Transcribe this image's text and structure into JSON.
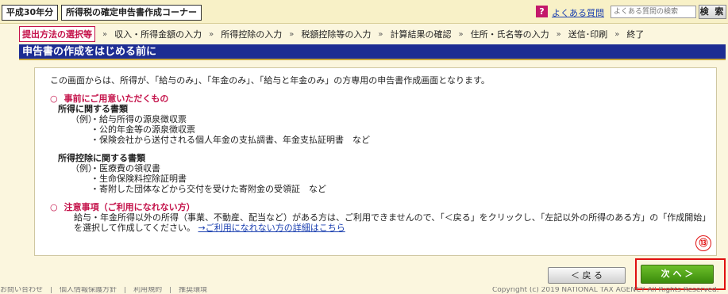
{
  "header": {
    "year_badge": "平成30年分",
    "corner_title": "所得税の確定申告書作成コーナー",
    "faq_icon": "?",
    "faq_link": "よくある質問",
    "search_placeholder": "よくある質問の検索",
    "search_button": "検 索"
  },
  "steps": [
    "提出方法の選択等",
    "収入・所得金額の入力",
    "所得控除の入力",
    "税額控除等の入力",
    "計算結果の確認",
    "住所・氏名等の入力",
    "送信･印刷",
    "終了"
  ],
  "step_separator": "»",
  "section_title": "申告書の作成をはじめる前に",
  "content": {
    "intro": "この画面からは、所得が、「給与のみ」、「年金のみ」、「給与と年金のみ」の方専用の申告書作成画面となります。",
    "circle": "○",
    "prepare_heading": "事前にご用意いただくもの",
    "income_docs_heading": "所得に関する書類",
    "example_label": "（例）",
    "income_docs": [
      "給与所得の源泉徴収票",
      "公的年金等の源泉徴収票",
      "保険会社から送付される個人年金の支払調書、年金支払証明書　など"
    ],
    "deduction_docs_heading": "所得控除に関する書類",
    "deduction_docs": [
      "医療費の領収書",
      "生命保険料控除証明書",
      "寄附した団体などから交付を受けた寄附金の受領証　など"
    ],
    "note_heading": "注意事項（ご利用になれない方）",
    "note_body": "給与・年金所得以外の所得（事業、不動産、配当など）がある方は、ご利用できませんので、「＜戻る」をクリックし、「左記以外の所得のある方」の「作成開始」を選択して作成してください。",
    "note_link": "→ご利用になれない方の詳細はこちら"
  },
  "buttons": {
    "back": "＜ 戻 る",
    "next": "次 へ ＞"
  },
  "marker": "⑬",
  "footer": {
    "left": "お問い合わせ　|　個人情報保護方針　|　利用規約　|　推奨環境",
    "right": "Copyright (c) 2019 NATIONAL TAX AGENCY All Rights Reserved."
  }
}
